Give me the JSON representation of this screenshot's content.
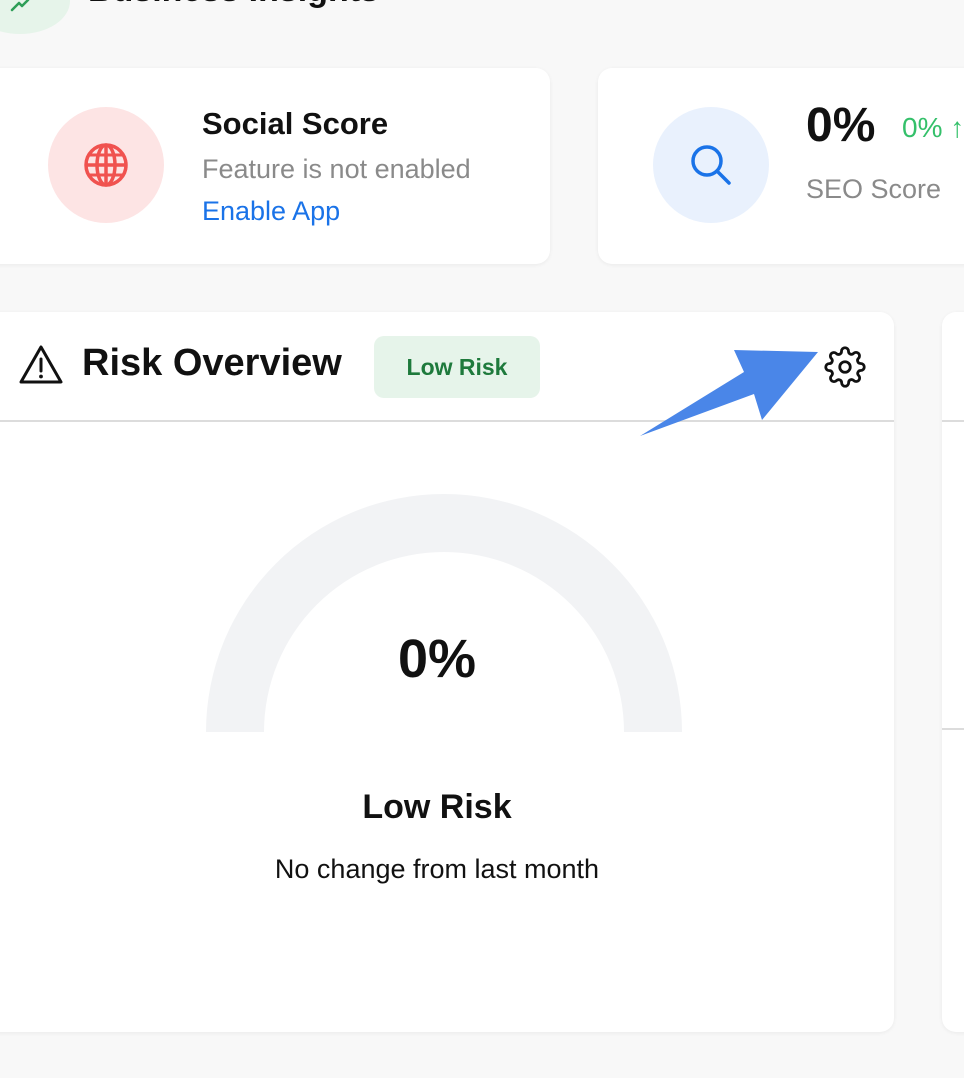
{
  "section": {
    "title": "Business Insights",
    "icon": "trend-up-icon"
  },
  "social_score": {
    "title": "Social Score",
    "subtitle": "Feature is not enabled",
    "link": "Enable App",
    "icon": "globe-icon"
  },
  "seo_score": {
    "value": "0%",
    "change": "0% ↑",
    "label": "SEO Score",
    "icon": "search-icon"
  },
  "risk_overview": {
    "title": "Risk Overview",
    "badge": "Low Risk",
    "gauge_percent": 0,
    "gauge_value": "0%",
    "risk_level": "Low Risk",
    "change_text": "No change from last month",
    "icons": [
      "warning-icon",
      "gear-icon"
    ]
  },
  "colors": {
    "accent_blue": "#1a73e8",
    "green": "#34c06a",
    "badge_bg": "#e6f4ea",
    "badge_text": "#1e7a3c",
    "social_bg": "#fde4e4",
    "social_icon": "#f0524f",
    "seo_bg": "#e9f1fd",
    "gauge_track": "#f2f3f5",
    "annotation_arrow": "#4a86e8"
  }
}
